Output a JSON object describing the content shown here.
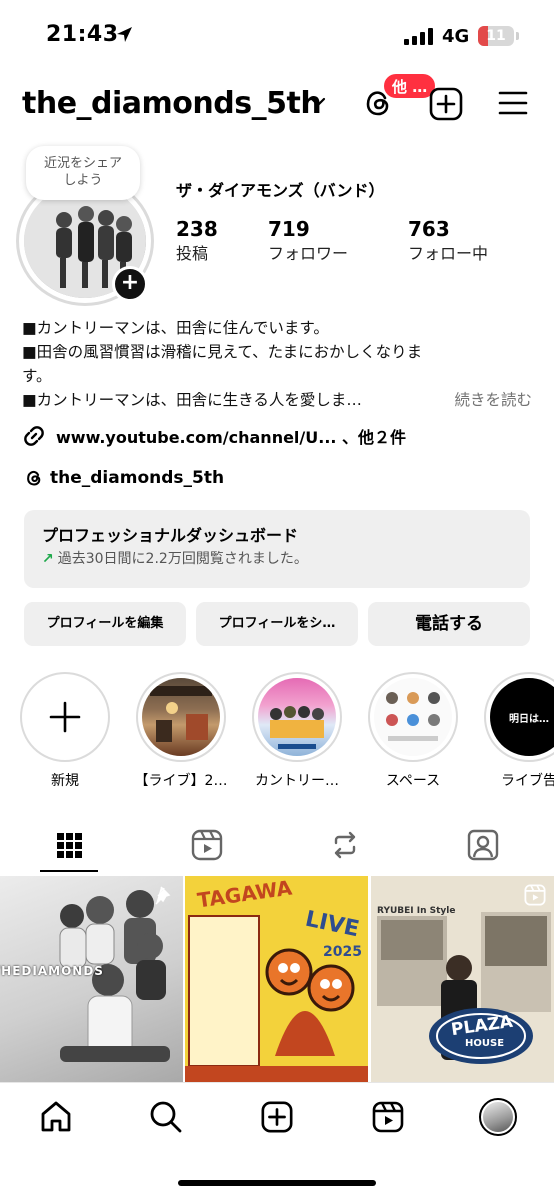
{
  "status_bar": {
    "time": "21:43",
    "network": "4G",
    "battery": "11",
    "battery_level": 0.11
  },
  "header": {
    "username": "the_diamonds_5th",
    "threads_badge": "他 …"
  },
  "profile": {
    "note": "近況をシェア\nしよう",
    "display_name": "ザ・ダイアモンズ（バンド）",
    "stats": [
      {
        "value": "238",
        "label": "投稿"
      },
      {
        "value": "719",
        "label": "フォロワー"
      },
      {
        "value": "763",
        "label": "フォロー中"
      }
    ],
    "bio_lines": [
      "■カントリーマンは、田舎に住んでいます。",
      "■田舎の風習慣習は滑稽に見えて、たまにおかしくなりま",
      "す。",
      "■カントリーマンは、田舎に生きる人を愛しま…"
    ],
    "bio_more": "続きを読む",
    "link_text": "www.youtube.com/channel/U... 、他２件",
    "threads_handle": "the_diamonds_5th"
  },
  "dashboard": {
    "title": "プロフェッショナルダッシュボード",
    "subtitle": "過去30日間に2.2万回閲覧されました。"
  },
  "actions": {
    "edit": "プロフィールを編集",
    "share": "プロフィールをシ…",
    "call": "電話する"
  },
  "highlights": [
    {
      "label": "新規"
    },
    {
      "label": "【ライブ】2…"
    },
    {
      "label": "カントリー…"
    },
    {
      "label": "スペース"
    },
    {
      "label": "ライブ告"
    }
  ],
  "highlight_texts": {
    "last_cover": "明日は…"
  },
  "grid_texts": {
    "post1": "THEDIAMONDS",
    "post2_title": "TAGAWA",
    "post2_live": "LIVE",
    "post2_year": "2025",
    "post3_brand1": "PLAZA",
    "post3_brand2": "HOUSE",
    "post3_header": "RYUBEI In Style"
  },
  "colors": {
    "badge": "#ff3040",
    "accent_green": "#1da84a",
    "button_bg": "#efefef"
  }
}
